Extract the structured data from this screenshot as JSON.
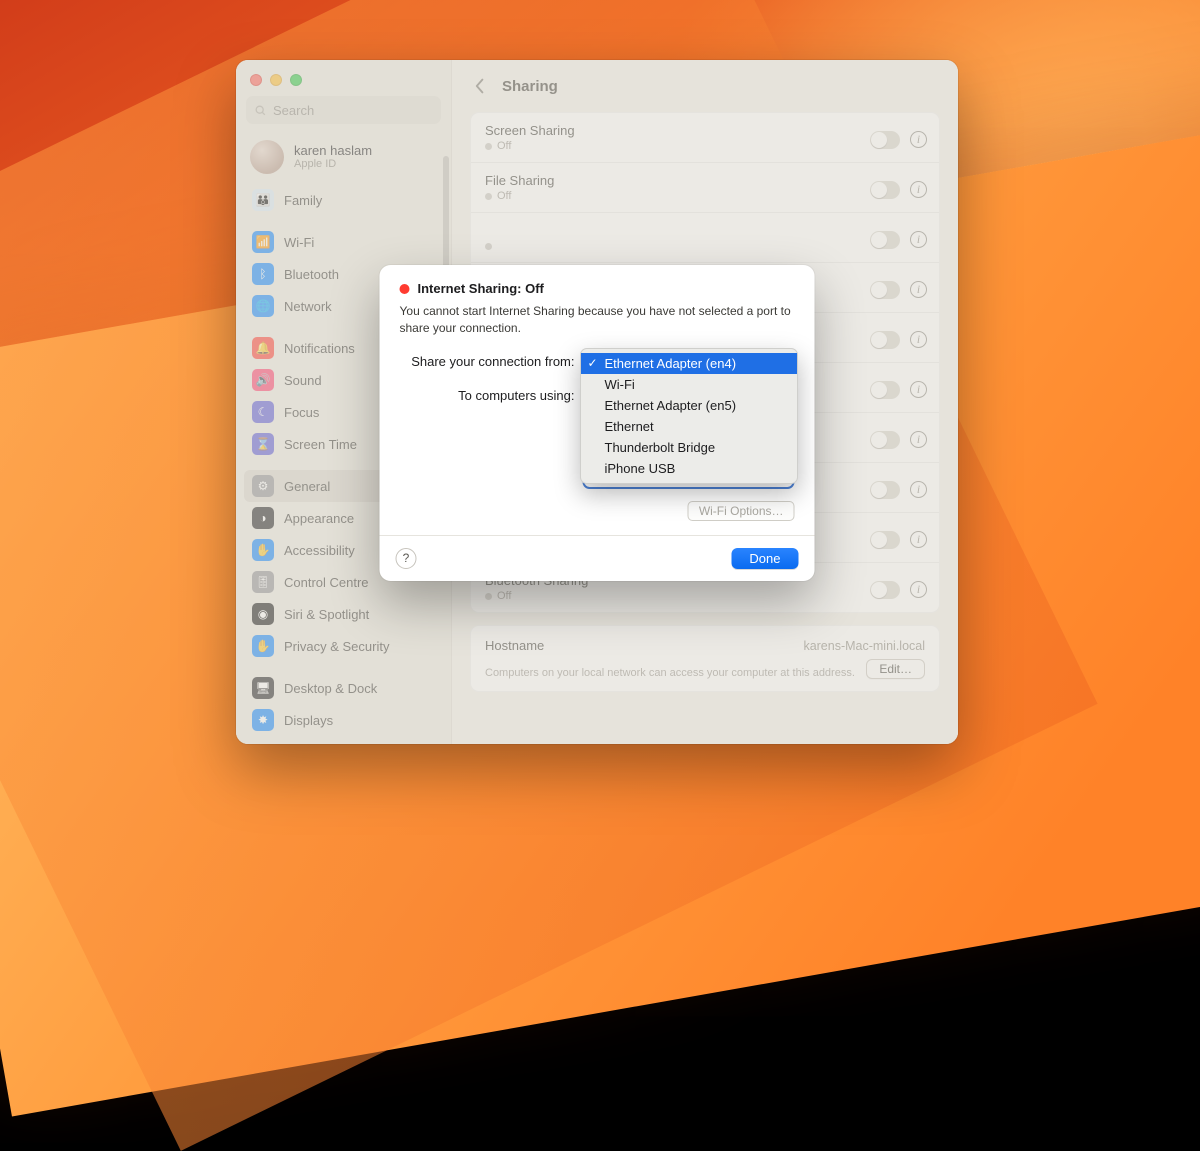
{
  "window_title": "Sharing",
  "search_placeholder": "Search",
  "account": {
    "name": "karen haslam",
    "sub": "Apple ID"
  },
  "sidebar": {
    "items": [
      {
        "label": "Family",
        "color": "#d8e8f7",
        "glyph": "👪",
        "fg": "#3a7bd5"
      },
      {
        "label": "Wi-Fi",
        "color": "#0a84ff",
        "glyph": "📶"
      },
      {
        "label": "Bluetooth",
        "color": "#0a84ff",
        "glyph": "ᛒ"
      },
      {
        "label": "Network",
        "color": "#0a84ff",
        "glyph": "🌐"
      },
      {
        "label": "Notifications",
        "color": "#ff3b30",
        "glyph": "🔔"
      },
      {
        "label": "Sound",
        "color": "#ff3b6b",
        "glyph": "🔊"
      },
      {
        "label": "Focus",
        "color": "#5856d6",
        "glyph": "☾"
      },
      {
        "label": "Screen Time",
        "color": "#5856d6",
        "glyph": "⌛"
      },
      {
        "label": "General",
        "color": "#8e8e93",
        "glyph": "⚙",
        "selected": true
      },
      {
        "label": "Appearance",
        "color": "#1c1c1e",
        "glyph": "◑"
      },
      {
        "label": "Accessibility",
        "color": "#0a84ff",
        "glyph": "✋"
      },
      {
        "label": "Control Centre",
        "color": "#8e8e93",
        "glyph": "🎚"
      },
      {
        "label": "Siri & Spotlight",
        "color": "#111",
        "glyph": "◉"
      },
      {
        "label": "Privacy & Security",
        "color": "#0a84ff",
        "glyph": "✋"
      },
      {
        "label": "Desktop & Dock",
        "color": "#1c1c1e",
        "glyph": "🖥"
      },
      {
        "label": "Displays",
        "color": "#0a84ff",
        "glyph": "✸"
      }
    ],
    "gap_after": [
      0,
      3,
      7,
      13
    ]
  },
  "services": [
    {
      "title": "Screen Sharing",
      "status": "Off"
    },
    {
      "title": "File Sharing",
      "status": "Off"
    },
    {
      "title": "",
      "status": ""
    },
    {
      "title": "",
      "status": ""
    },
    {
      "title": "",
      "status": ""
    },
    {
      "title": "",
      "status": ""
    },
    {
      "title": "",
      "status": ""
    },
    {
      "title": "",
      "status": ""
    },
    {
      "title": "",
      "status": ""
    },
    {
      "title": "Bluetooth Sharing",
      "status": "Off"
    }
  ],
  "host": {
    "label": "Hostname",
    "value": "karens-Mac-mini.local",
    "desc": "Computers on your local network can access your computer at this address.",
    "edit": "Edit…"
  },
  "sheet": {
    "title": "Internet Sharing: Off",
    "desc": "You cannot start Internet Sharing because you have not selected a port to share your connection.",
    "from_label": "Share your connection from:",
    "to_label": "To computers using:",
    "ports": [
      {
        "label": "Ethernet Adapter (en4)",
        "selected": true
      },
      {
        "label": "Ethernet Adapter (en5)"
      },
      {
        "label": "Thunderbolt Bridge"
      },
      {
        "label": "iPhone USB"
      }
    ],
    "dropdown_options": [
      {
        "label": "Ethernet Adapter (en4)",
        "selected": true
      },
      {
        "label": "Wi-Fi"
      },
      {
        "label": "Ethernet Adapter (en5)"
      },
      {
        "label": "Ethernet"
      },
      {
        "label": "Thunderbolt Bridge"
      },
      {
        "label": "iPhone USB"
      }
    ],
    "wifi_options": "Wi-Fi Options…",
    "done": "Done"
  }
}
